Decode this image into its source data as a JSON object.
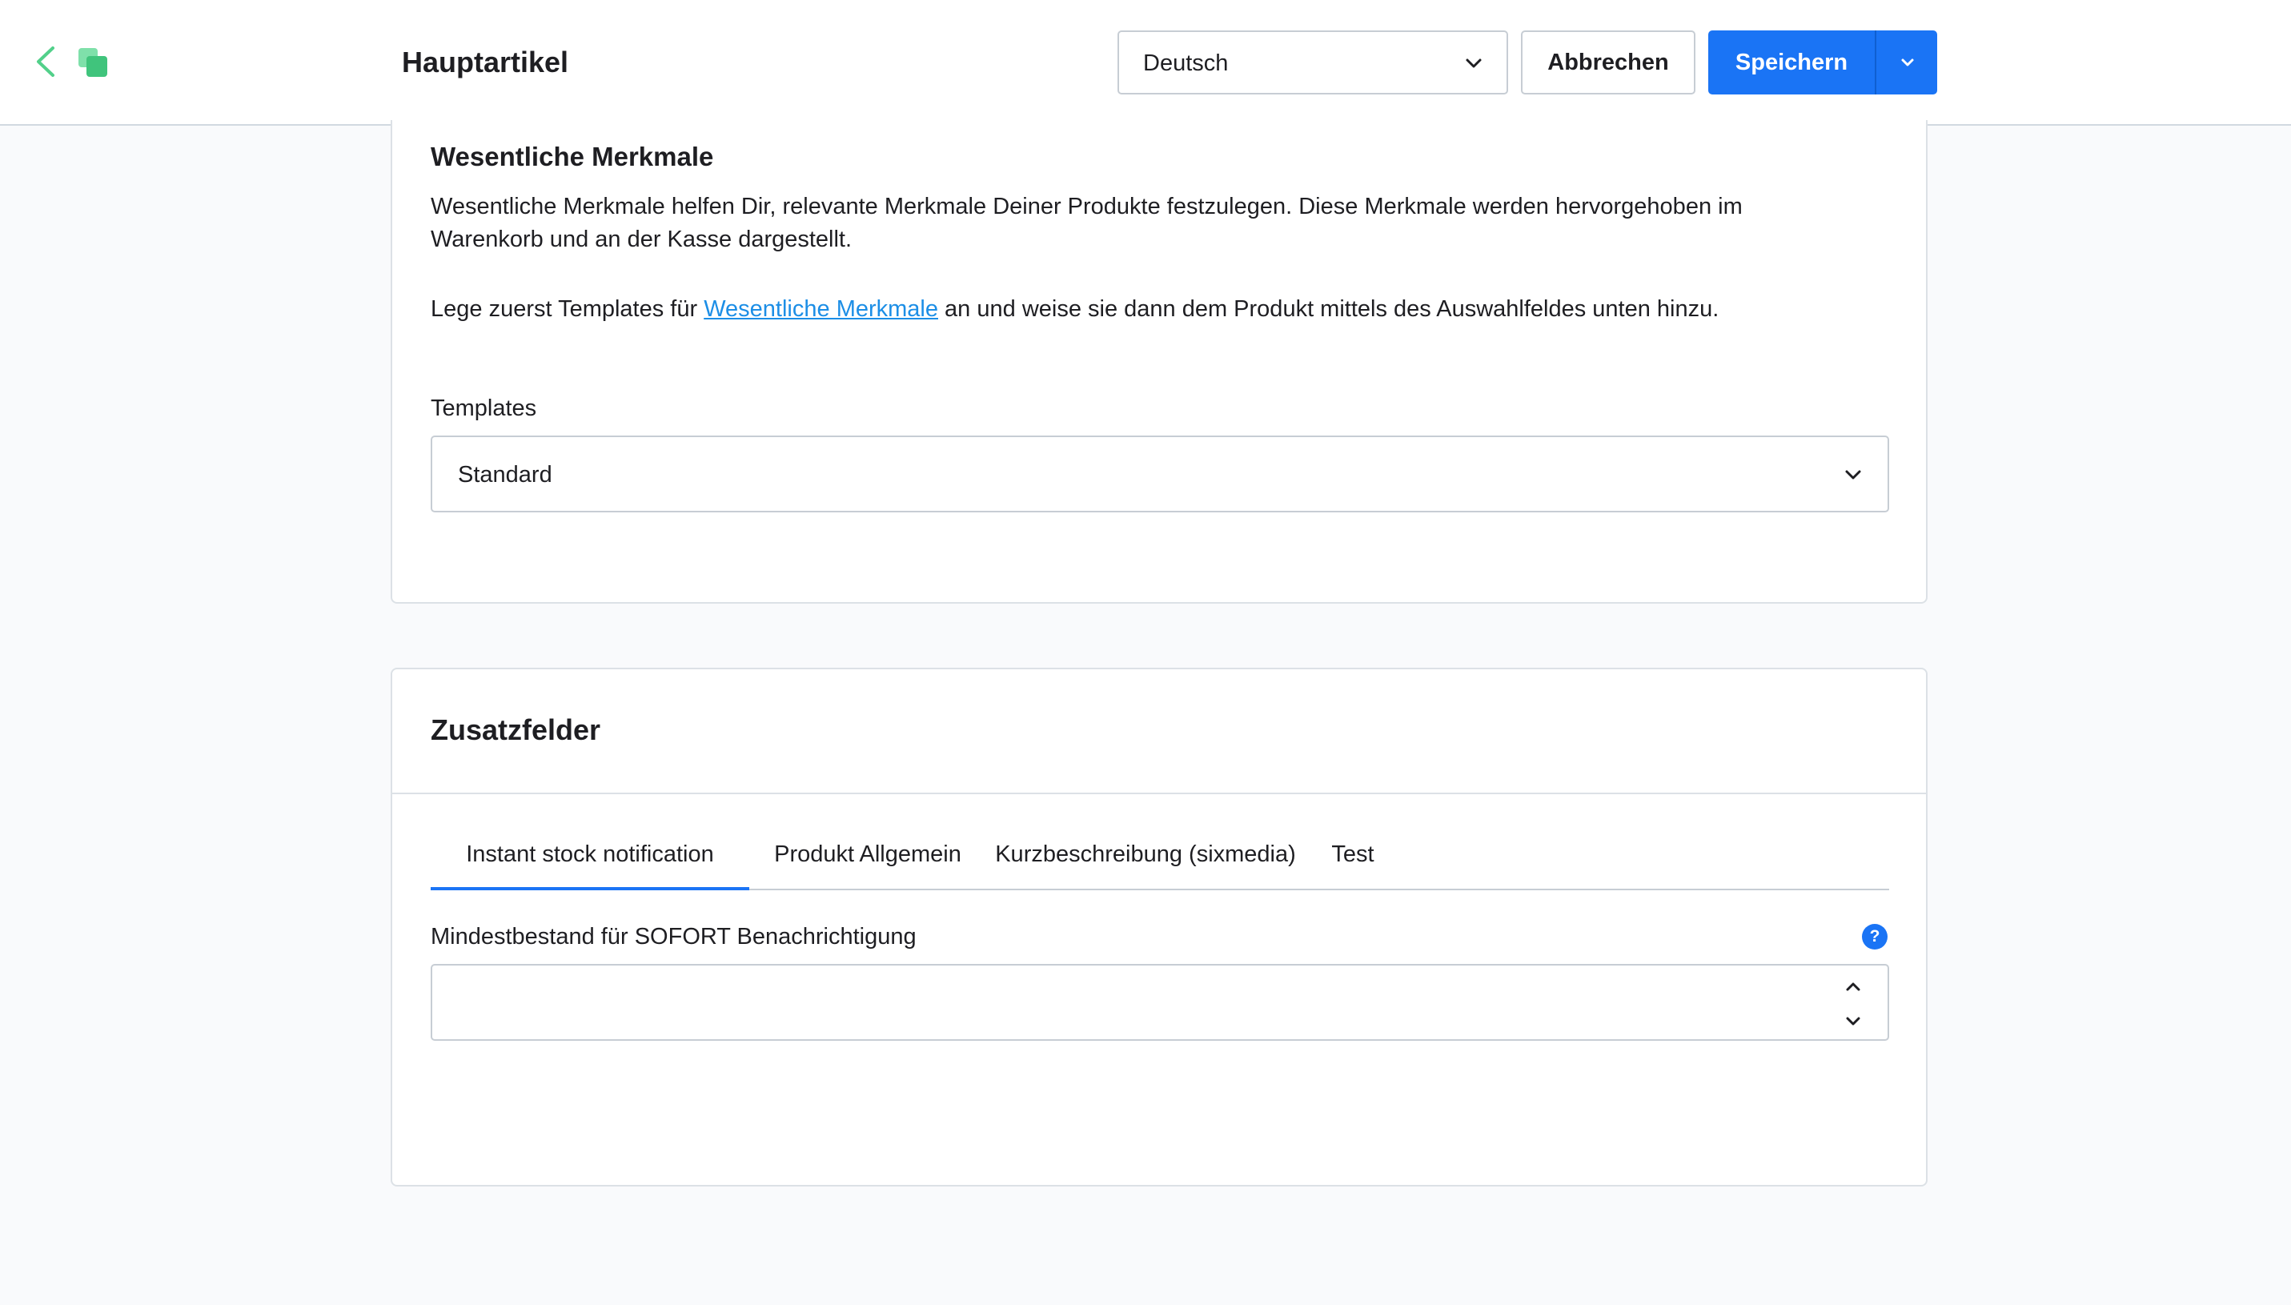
{
  "header": {
    "title": "Hauptartikel",
    "language": "Deutsch",
    "cancel_label": "Abbrechen",
    "save_label": "Speichern"
  },
  "essential": {
    "title": "Wesentliche Merkmale",
    "description": "Wesentliche Merkmale helfen Dir, relevante Merkmale Deiner Produkte festzulegen. Diese Merkmale werden hervorgehoben im Warenkorb und an der Kasse dargestellt.",
    "hint_before": "Lege zuerst Templates für ",
    "hint_link": "Wesentliche Merkmale",
    "hint_after": " an und weise sie dann dem Produkt mittels des Auswahlfeldes unten hinzu.",
    "templates_label": "Templates",
    "templates_value": "Standard"
  },
  "custom_fields": {
    "title": "Zusatzfelder",
    "tabs": [
      {
        "label": "Instant stock notification",
        "active": true
      },
      {
        "label": "Produkt Allgemein",
        "active": false
      },
      {
        "label": "Kurzbeschreibung (sixmedia)",
        "active": false
      },
      {
        "label": "Test",
        "active": false
      }
    ],
    "field_label": "Mindestbestand für SOFORT Benachrichtigung",
    "field_value": "",
    "help_glyph": "?"
  },
  "colors": {
    "primary": "#1a74f5",
    "link": "#1c8ee6",
    "module_icon": "#52d08a"
  },
  "icons": [
    "chevron-left-icon",
    "copy-icon",
    "chevron-down-icon",
    "chevron-up-icon",
    "help-icon"
  ]
}
